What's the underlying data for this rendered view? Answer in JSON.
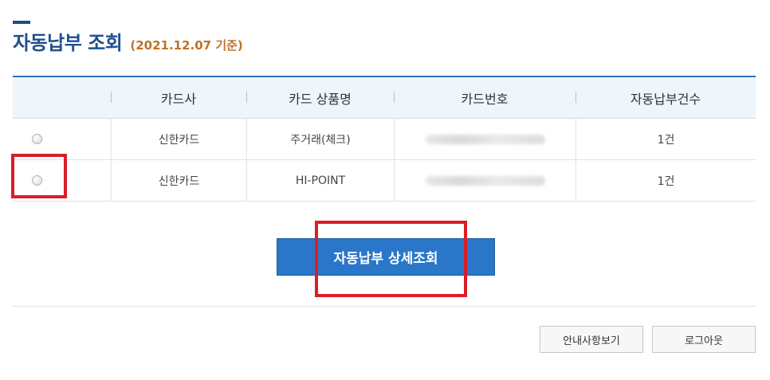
{
  "header": {
    "title": "자동납부 조회",
    "subtitle": "(2021.12.07 기준)"
  },
  "table": {
    "columns": [
      "",
      "카드사",
      "카드 상품명",
      "카드번호",
      "자동납부건수"
    ],
    "rows": [
      {
        "company": "신한카드",
        "product": "주거래(체크)",
        "card_number": "",
        "count": "1건",
        "selected": false
      },
      {
        "company": "신한카드",
        "product": "HI-POINT",
        "card_number": "",
        "count": "1건",
        "selected": false
      }
    ]
  },
  "actions": {
    "detail_label": "자동납부 상세조회",
    "notice_label": "안내사항보기",
    "logout_label": "로그아웃"
  },
  "colors": {
    "title": "#1f4f8f",
    "subtitle": "#c0712a",
    "accent": "#2a77c9",
    "highlight": "#d81f26"
  }
}
